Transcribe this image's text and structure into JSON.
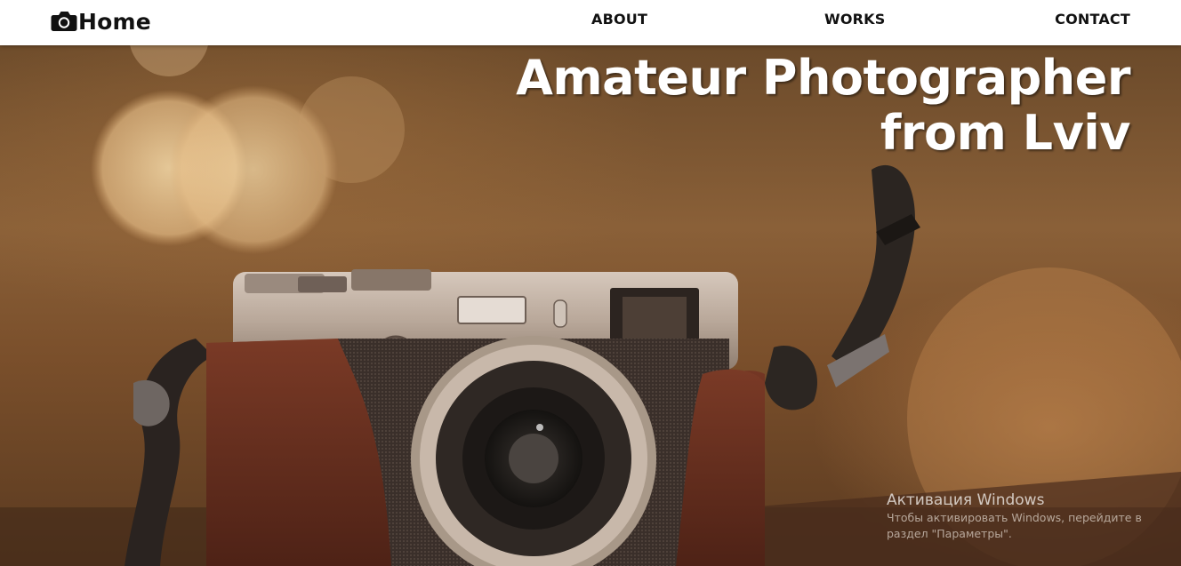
{
  "header": {
    "brand": {
      "icon": "camera-icon",
      "label": "Home"
    },
    "nav": [
      {
        "label": "ABOUT"
      },
      {
        "label": "WORKS"
      },
      {
        "label": "CONTACT"
      }
    ]
  },
  "hero": {
    "title_line1": "Amateur Photographer",
    "title_line2": "from Lviv",
    "background": "vintage-camera-photo"
  },
  "watermark": {
    "title": "Активация Windows",
    "line1": "Чтобы активировать Windows, перейдите в",
    "line2": "раздел \"Параметры\"."
  },
  "colors": {
    "header_bg": "#ffffff",
    "nav_text": "#111111",
    "hero_text": "#ffffff"
  }
}
